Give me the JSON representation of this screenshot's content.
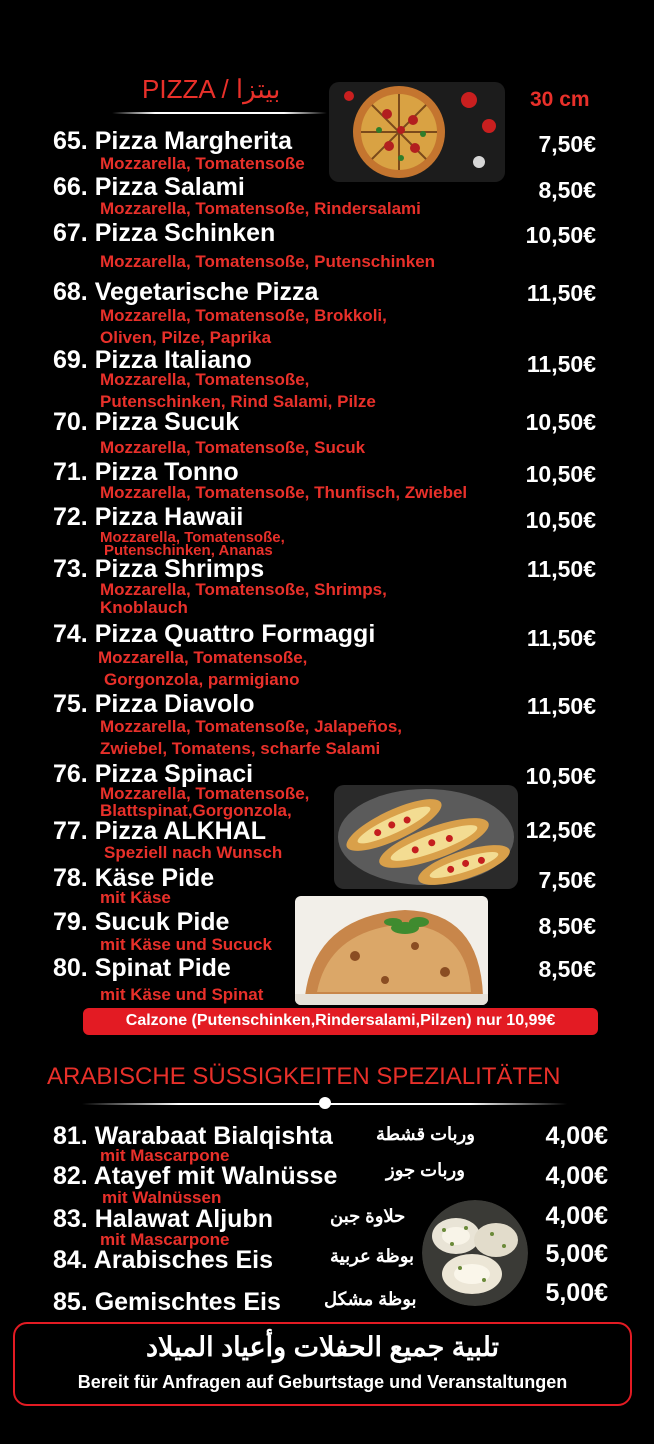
{
  "pizza_section": {
    "title": "PIZZA / بيتزا",
    "size_label": "30 cm"
  },
  "pizzas": [
    {
      "name": "65. Pizza Margherita",
      "price": "7,50€",
      "desc": [
        "Mozzarella, Tomatensoße"
      ]
    },
    {
      "name": "66. Pizza Salami",
      "price": "8,50€",
      "desc": [
        "Mozzarella, Tomatensoße, Rindersalami"
      ]
    },
    {
      "name": "67. Pizza Schinken",
      "price": "10,50€",
      "desc": [
        "Mozzarella, Tomatensoße, Putenschinken"
      ]
    },
    {
      "name": "68. Vegetarische Pizza",
      "price": "11,50€",
      "desc": [
        "Mozzarella, Tomatensoße, Brokkoli,",
        "Oliven, Pilze, Paprika"
      ]
    },
    {
      "name": "69. Pizza Italiano",
      "price": "11,50€",
      "desc": [
        "Mozzarella, Tomatensoße,",
        "Putenschinken, Rind Salami, Pilze"
      ]
    },
    {
      "name": "70. Pizza Sucuk",
      "price": "10,50€",
      "desc": [
        "Mozzarella, Tomatensoße, Sucuk"
      ]
    },
    {
      "name": "71. Pizza Tonno",
      "price": "10,50€",
      "desc": [
        "Mozzarella, Tomatensoße, Thunfisch, Zwiebel"
      ]
    },
    {
      "name": "72. Pizza Hawaii",
      "price": "10,50€",
      "desc": [
        "Mozzarella, Tomatensoße,",
        "Putenschinken, Ananas"
      ]
    },
    {
      "name": "73. Pizza Shrimps",
      "price": "11,50€",
      "desc": [
        "Mozzarella, Tomatensoße, Shrimps,",
        "Knoblauch"
      ]
    },
    {
      "name": "74. Pizza Quattro Formaggi",
      "price": "11,50€",
      "desc": [
        "Mozzarella, Tomatensoße,",
        "Gorgonzola, parmigiano"
      ]
    },
    {
      "name": "75. Pizza Diavolo",
      "price": "11,50€",
      "desc": [
        "Mozzarella, Tomatensoße, Jalapeños,",
        "Zwiebel, Tomatens, scharfe Salami"
      ]
    },
    {
      "name": "76. Pizza Spinaci",
      "price": "10,50€",
      "desc": [
        "Mozzarella, Tomatensoße,",
        "Blattspinat,Gorgonzola,"
      ]
    },
    {
      "name": "77. Pizza ALKHAL",
      "price": "12,50€",
      "desc": [
        "Speziell nach Wunsch"
      ]
    },
    {
      "name": "78. Käse Pide",
      "price": "7,50€",
      "desc": [
        "mit Käse"
      ]
    },
    {
      "name": "79. Sucuk Pide",
      "price": "8,50€",
      "desc": [
        "mit Käse und Sucuck"
      ]
    },
    {
      "name": "80. Spinat Pide",
      "price": "8,50€",
      "desc": [
        "mit Käse und Spinat"
      ]
    }
  ],
  "calzone_banner": "Calzone (Putenschinken,Rindersalami,Pilzen) nur 10,99€",
  "sweets_section": {
    "title": "ARABISCHE SÜSSIGKEITEN SPEZIALITÄTEN"
  },
  "sweets": [
    {
      "name": "81. Warabaat Bialqishta",
      "arabic": "وربات قشطة",
      "price": "4,00€",
      "desc": "mit Mascarpone"
    },
    {
      "name": "82. Atayef mit Walnüsse",
      "arabic": "وربات جوز",
      "price": "4,00€",
      "desc": "mit Walnüssen"
    },
    {
      "name": "83. Halawat Aljubn",
      "arabic": "حلاوة جبن",
      "price": "4,00€",
      "desc": "mit Mascarpone"
    },
    {
      "name": "84. Arabisches Eis",
      "arabic": "بوظة عربية",
      "price": "5,00€",
      "desc": ""
    },
    {
      "name": "85. Gemischtes Eis",
      "arabic": "بوظة مشكل",
      "price": "5,00€",
      "desc": ""
    }
  ],
  "footer": {
    "arabic": "تلبية جميع الحفلات وأعياد الميلاد",
    "german": "Bereit für Anfragen auf Geburtstage und Veranstaltungen"
  },
  "colors": {
    "accent_red": "#e8302a",
    "background": "#000000",
    "text": "#ffffff"
  },
  "images": [
    "pizza-photo",
    "pide-photo",
    "calzone-photo",
    "halawat-photo"
  ]
}
